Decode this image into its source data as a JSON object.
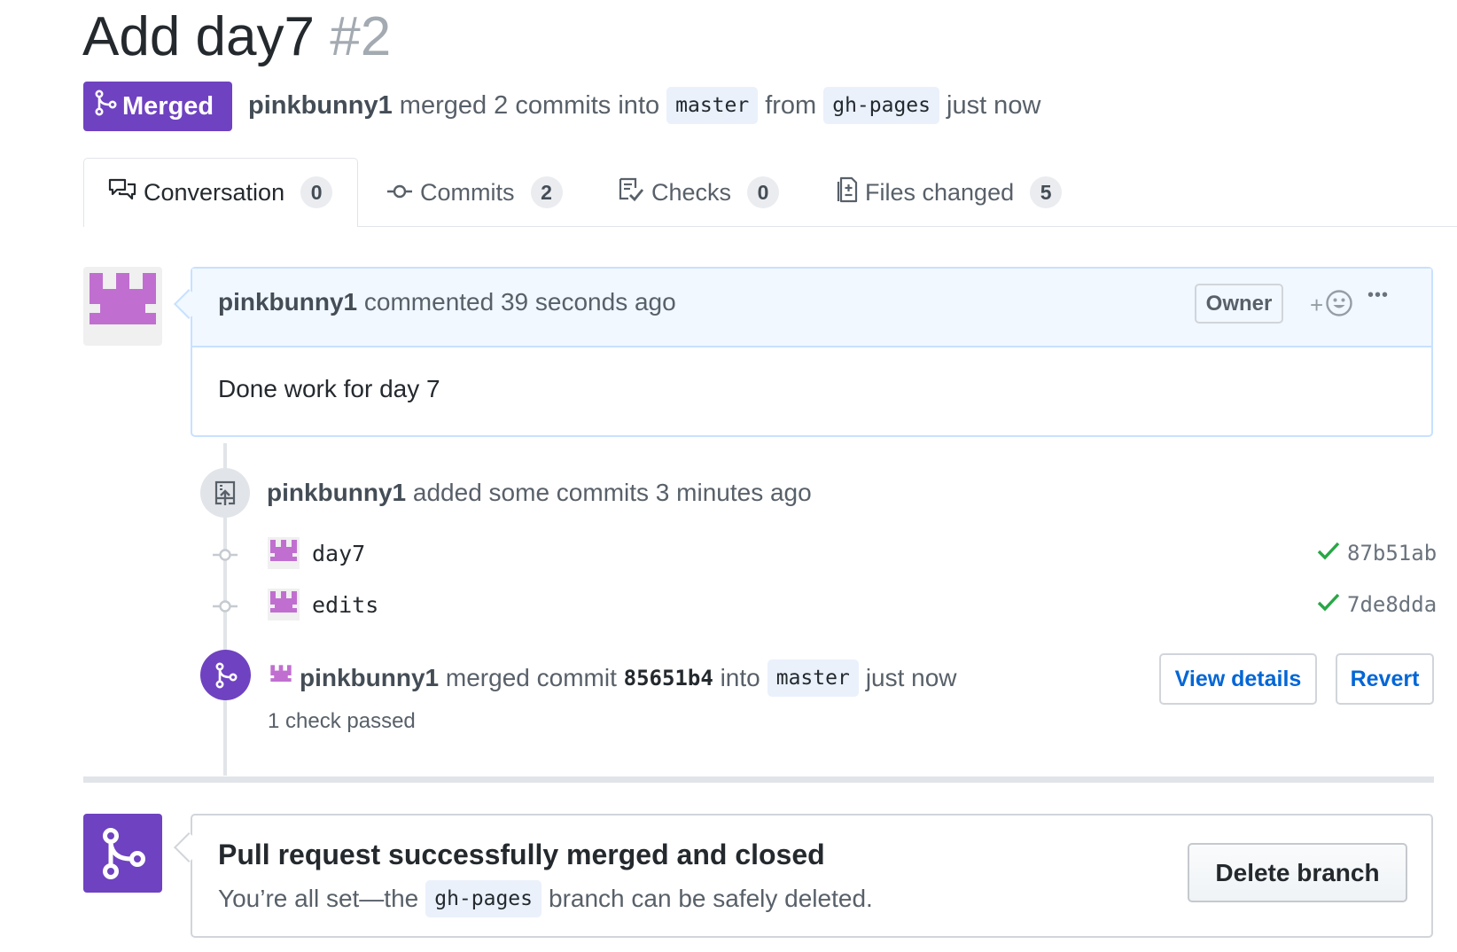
{
  "pr": {
    "title": "Add day7",
    "number": "#2",
    "status_label": "Merged",
    "author": "pinkbunny1",
    "meta_merged": "merged 2 commits into",
    "base_branch": "master",
    "meta_from": "from",
    "head_branch": "gh-pages",
    "meta_time": "just now"
  },
  "tabs": [
    {
      "label": "Conversation",
      "count": "0",
      "icon": "comment-discussion-icon"
    },
    {
      "label": "Commits",
      "count": "2",
      "icon": "git-commit-icon"
    },
    {
      "label": "Checks",
      "count": "0",
      "icon": "checklist-icon"
    },
    {
      "label": "Files changed",
      "count": "5",
      "icon": "diff-icon"
    }
  ],
  "comment": {
    "author": "pinkbunny1",
    "action": "commented 39 seconds ago",
    "role_badge": "Owner",
    "reaction_plus": "+",
    "more": "•••",
    "body": "Done work for day 7"
  },
  "timeline": {
    "commits_event": {
      "author": "pinkbunny1",
      "text": "added some commits 3 minutes ago"
    },
    "commits": [
      {
        "message": "day7",
        "sha": "87b51ab",
        "status": "success"
      },
      {
        "message": "edits",
        "sha": "7de8dda",
        "status": "success"
      }
    ],
    "merge_event": {
      "author": "pinkbunny1",
      "text_merged": "merged commit",
      "commit": "85651b4",
      "text_into": "into",
      "branch": "master",
      "time": "just now",
      "checks": "1 check passed",
      "view_details_label": "View details",
      "revert_label": "Revert"
    }
  },
  "merge_box": {
    "title": "Pull request successfully merged and closed",
    "desc_before": "You’re all set—the",
    "branch": "gh-pages",
    "desc_after": "branch can be safely deleted.",
    "delete_label": "Delete branch"
  },
  "colors": {
    "merged_purple": "#6f42c1",
    "avatar_purple": "#c06fd0",
    "link_blue": "#0366d6",
    "success_green": "#28a745"
  }
}
